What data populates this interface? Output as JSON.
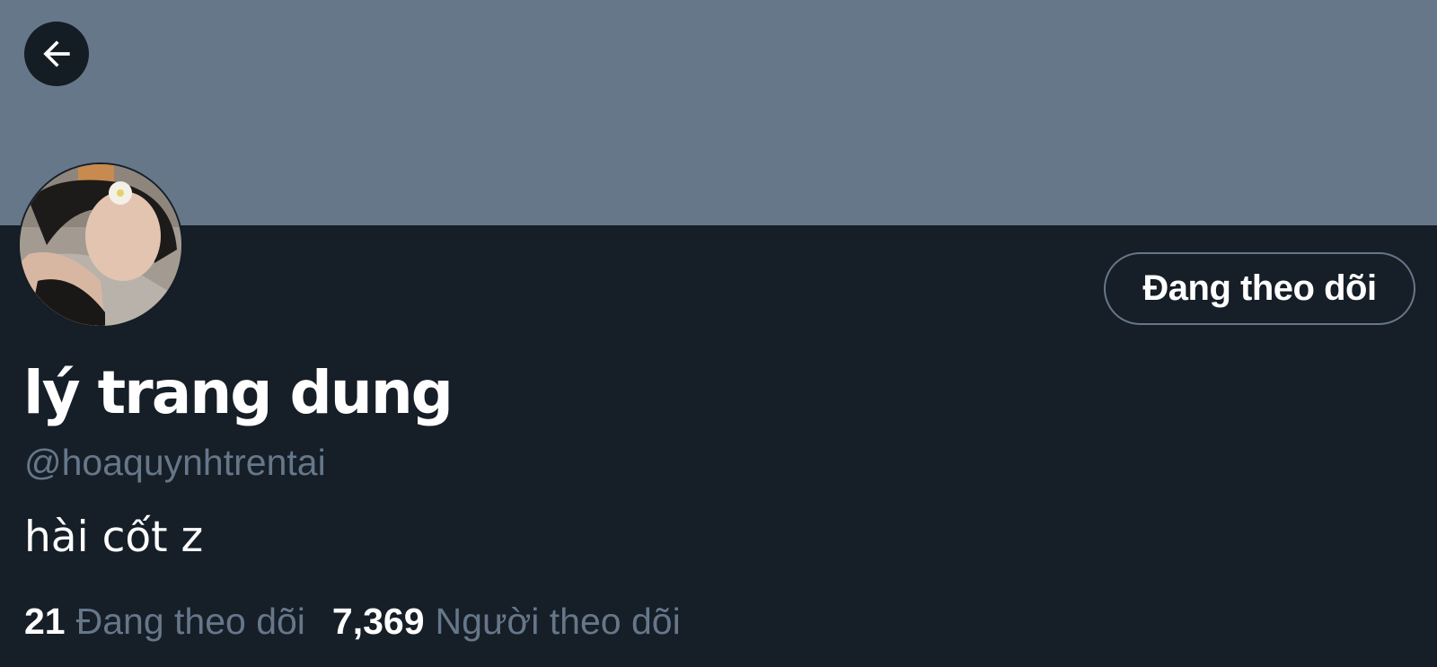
{
  "header": {
    "back_icon": "arrow-left-icon",
    "banner_color": "#66778a",
    "background_color": "#161e27"
  },
  "profile": {
    "display_name": "lý trang dung",
    "handle": "@hoaquynhtrentai",
    "bio": "hài cốt z",
    "follow_button_label": "Đang theo dõi"
  },
  "stats": {
    "following_count": "21",
    "following_label": "Đang theo dõi",
    "followers_count": "7,369",
    "followers_label": "Người theo dõi"
  },
  "colors": {
    "muted_text": "#66778a",
    "primary_text": "#ffffff"
  }
}
